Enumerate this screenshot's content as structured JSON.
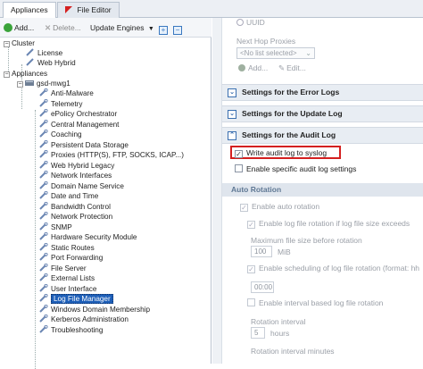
{
  "tabs": [
    {
      "label": "Appliances",
      "active": true
    },
    {
      "label": "File Editor",
      "active": false
    }
  ],
  "toolbar": {
    "add": "Add...",
    "delete": "Delete...",
    "update": "Update Engines"
  },
  "tree": {
    "cluster": "Cluster",
    "license": "License",
    "web_hybrid": "Web Hybrid",
    "appliances": "Appliances",
    "host": "gsd-mwg1",
    "items": [
      "Anti-Malware",
      "Telemetry",
      "ePolicy Orchestrator",
      "Central Management",
      "Coaching",
      "Persistent Data Storage",
      "Proxies (HTTP(S), FTP, SOCKS, ICAP...)",
      "Web Hybrid Legacy",
      "Network Interfaces",
      "Domain Name Service",
      "Date and Time",
      "Bandwidth Control",
      "Network Protection",
      "SNMP",
      "Hardware Security Module",
      "Static Routes",
      "Port Forwarding",
      "File Server",
      "External Lists",
      "User Interface",
      "Log File Manager",
      "Windows Domain Membership",
      "Kerberos Administration",
      "Troubleshooting"
    ],
    "selected_index": 20
  },
  "settings": {
    "uuid_label": "UUID",
    "next_hop_label": "Next Hop Proxies",
    "next_hop_value": "<No list selected>",
    "add": "Add...",
    "edit": "Edit...",
    "sections": [
      "Settings for the Error Logs",
      "Settings for the Update Log",
      "Settings for the Audit Log"
    ],
    "write_syslog": "Write audit log to syslog",
    "specific_audit": "Enable specific audit log settings",
    "auto_rotation": "Auto Rotation",
    "enable_auto": "Enable auto rotation",
    "enable_size": "Enable log file rotation if log file size exceeds",
    "max_size_label": "Maximum file size before rotation",
    "max_size_value": "100",
    "max_size_unit": "MiB",
    "enable_schedule": "Enable scheduling of log file rotation (format: hh",
    "schedule_value": "00:00",
    "enable_interval": "Enable interval based log file rotation",
    "interval_label": "Rotation interval",
    "interval_value": "5",
    "interval_unit": "hours",
    "interval_minutes_label": "Rotation interval minutes"
  }
}
